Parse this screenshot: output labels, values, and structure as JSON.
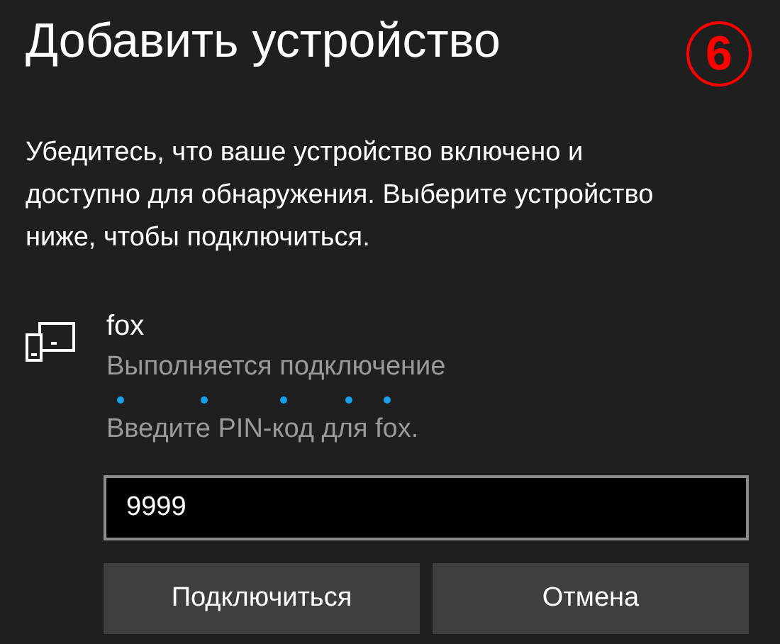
{
  "title": "Добавить устройство",
  "badge": "6",
  "description": "Убедитесь, что ваше устройство включено и доступно для обнаружения. Выберите устройство ниже, чтобы подключиться.",
  "device": {
    "name": "fox",
    "status": "Выполняется подключение",
    "prompt": "Введите PIN-код для fox."
  },
  "pin_field": {
    "value": "9999"
  },
  "buttons": [
    "Подключиться",
    "Отмена"
  ]
}
